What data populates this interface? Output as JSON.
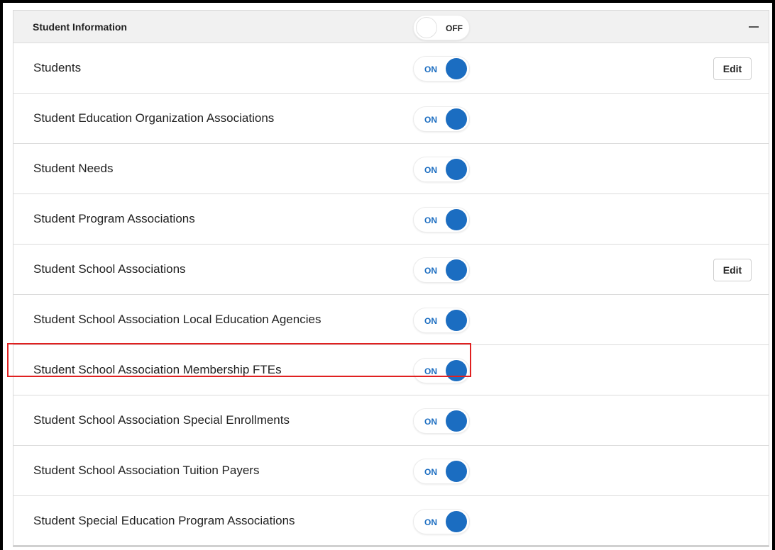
{
  "section": {
    "title": "Student Information",
    "toggle_label": "OFF",
    "collapse_icon": "minus-icon"
  },
  "toggle_on_label": "ON",
  "edit_label": "Edit",
  "colors": {
    "toggle_on": "#1b6dc1",
    "highlight_border": "#e02020",
    "header_bg": "#f1f1f1"
  },
  "rows": [
    {
      "label": "Students",
      "toggle": "ON",
      "has_edit": true
    },
    {
      "label": "Student Education Organization Associations",
      "toggle": "ON",
      "has_edit": false
    },
    {
      "label": "Student Needs",
      "toggle": "ON",
      "has_edit": false
    },
    {
      "label": "Student Program Associations",
      "toggle": "ON",
      "has_edit": false
    },
    {
      "label": "Student School Associations",
      "toggle": "ON",
      "has_edit": true
    },
    {
      "label": "Student School Association Local Education Agencies",
      "toggle": "ON",
      "has_edit": false
    },
    {
      "label": "Student School Association Membership FTEs",
      "toggle": "ON",
      "has_edit": false,
      "highlighted": true
    },
    {
      "label": "Student School Association Special Enrollments",
      "toggle": "ON",
      "has_edit": false
    },
    {
      "label": "Student School Association Tuition Payers",
      "toggle": "ON",
      "has_edit": false
    },
    {
      "label": "Student Special Education Program Associations",
      "toggle": "ON",
      "has_edit": false
    }
  ]
}
